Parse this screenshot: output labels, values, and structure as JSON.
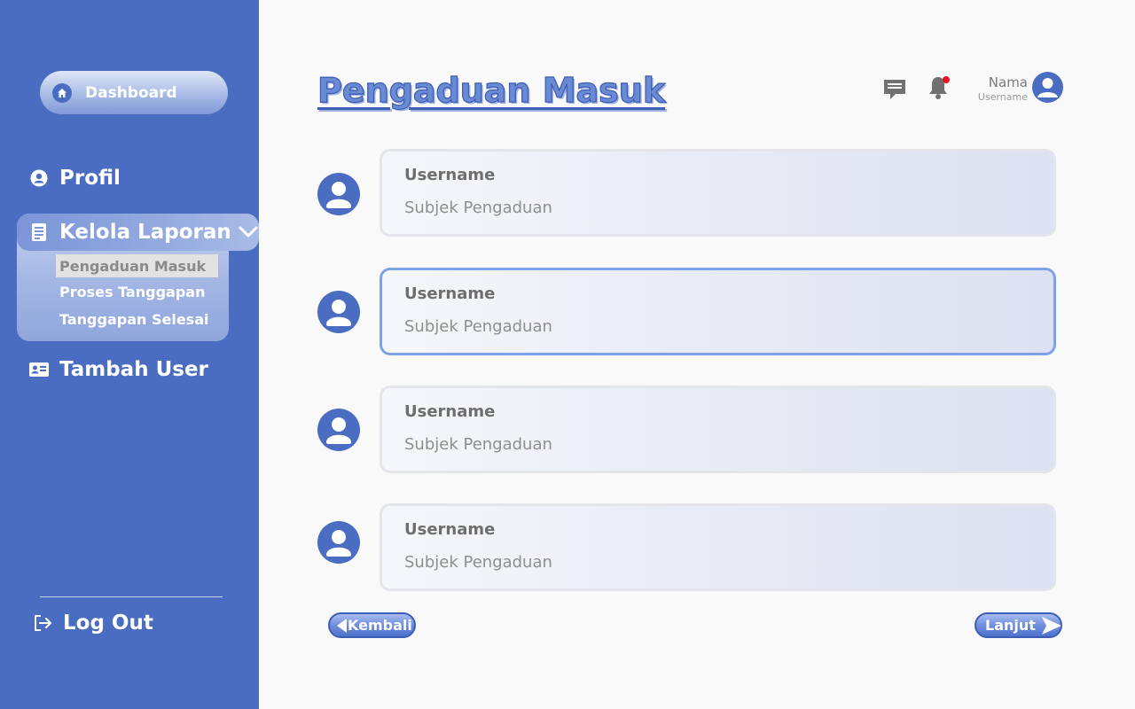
{
  "sidebar": {
    "dashboard_label": "Dashboard",
    "profil_label": "Profil",
    "kelola_label": "Kelola Laporan",
    "sub_items": [
      "Pengaduan Masuk",
      "Proses Tanggapan",
      "Tanggapan Selesai"
    ],
    "tambah_user_label": "Tambah User",
    "logout_label": "Log Out"
  },
  "header": {
    "title": "Pengaduan Masuk",
    "user_name": "Nama",
    "user_username": "Username",
    "icons": [
      "chat-icon",
      "bell-icon",
      "avatar"
    ]
  },
  "complaints": [
    {
      "username": "Username",
      "subject": "Subjek Pengaduan"
    },
    {
      "username": "Username",
      "subject": "Subjek Pengaduan"
    },
    {
      "username": "Username",
      "subject": "Subjek Pengaduan"
    },
    {
      "username": "Username",
      "subject": "Subjek Pengaduan"
    }
  ],
  "pagination": {
    "back_label": "Kembali",
    "next_label": "Lanjut"
  },
  "colors": {
    "primary": "#4a6dc1",
    "selected_border": "#7ea2e8",
    "notification_dot": "#e81123"
  }
}
